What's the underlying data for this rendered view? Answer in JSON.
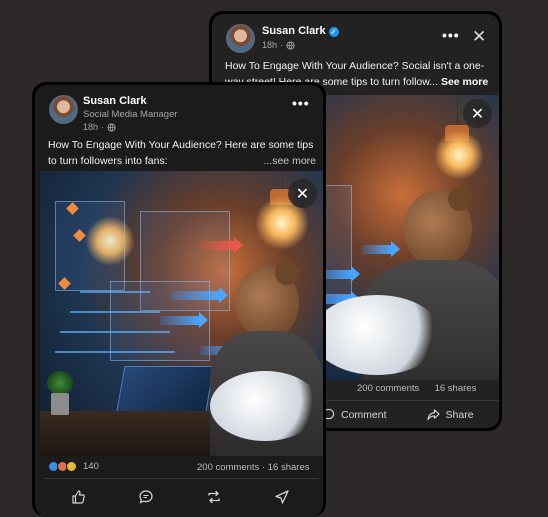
{
  "back_post": {
    "author": "Susan Clark",
    "time": "18h",
    "text": "How To Engage With Your Audience? Social isn't a one-way street! Here are some tips to turn follow...",
    "see_more": "See more",
    "comments": "200 comments",
    "shares": "16 shares",
    "comment_label": "Comment",
    "share_label": "Share"
  },
  "front_post": {
    "author": "Susan Clark",
    "title": "Social Media Manager",
    "time": "18h",
    "text": "How To Engage With Your Audience? Here are some tips to turn followers into fans:",
    "see_more": "...see more",
    "reactions": "140",
    "comments": "200 comments",
    "shares": "16 shares"
  },
  "colors": {
    "accent_blue": "#49a6ff",
    "verified": "#1d9bf0"
  },
  "icons": [
    "globe-icon",
    "more-icon",
    "close-icon",
    "like-icon",
    "comment-icon",
    "repost-icon",
    "send-icon",
    "share-icon",
    "verified-icon"
  ]
}
